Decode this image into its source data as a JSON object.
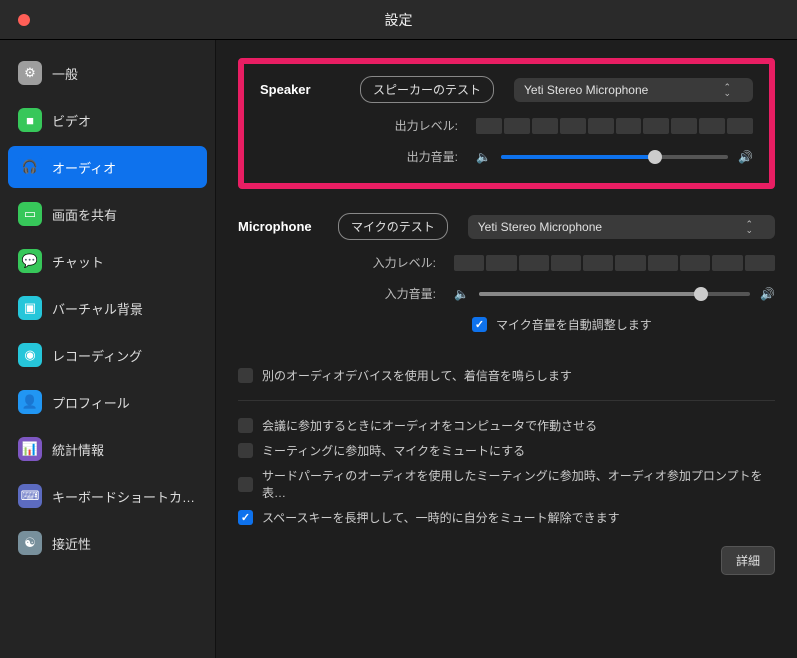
{
  "window": {
    "title": "設定"
  },
  "sidebar": {
    "items": [
      {
        "label": "一般"
      },
      {
        "label": "ビデオ"
      },
      {
        "label": "オーディオ"
      },
      {
        "label": "画面を共有"
      },
      {
        "label": "チャット"
      },
      {
        "label": "バーチャル背景"
      },
      {
        "label": "レコーディング"
      },
      {
        "label": "プロフィール"
      },
      {
        "label": "統計情報"
      },
      {
        "label": "キーボードショートカ…"
      },
      {
        "label": "接近性"
      }
    ]
  },
  "speaker": {
    "section": "Speaker",
    "test_btn": "スピーカーのテスト",
    "device": "Yeti Stereo Microphone",
    "output_level_label": "出力レベル:",
    "output_volume_label": "出力音量:",
    "volume_pct": 68
  },
  "mic": {
    "section": "Microphone",
    "test_btn": "マイクのテスト",
    "device": "Yeti Stereo Microphone",
    "input_level_label": "入力レベル:",
    "input_volume_label": "入力音量:",
    "volume_pct": 82,
    "auto_adjust": "マイク音量を自動調整します"
  },
  "options": {
    "separate_ringtone": "別のオーディオデバイスを使用して、着信音を鳴らします",
    "join_audio_computer": "会議に参加するときにオーディオをコンピュータで作動させる",
    "mute_on_join": "ミーティングに参加時、マイクをミュートにする",
    "third_party": "サードパーティのオーディオを使用したミーティングに参加時、オーディオ参加プロンプトを表…",
    "push_to_unmute": "スペースキーを長押しして、一時的に自分をミュート解除できます",
    "advanced": "詳細"
  }
}
